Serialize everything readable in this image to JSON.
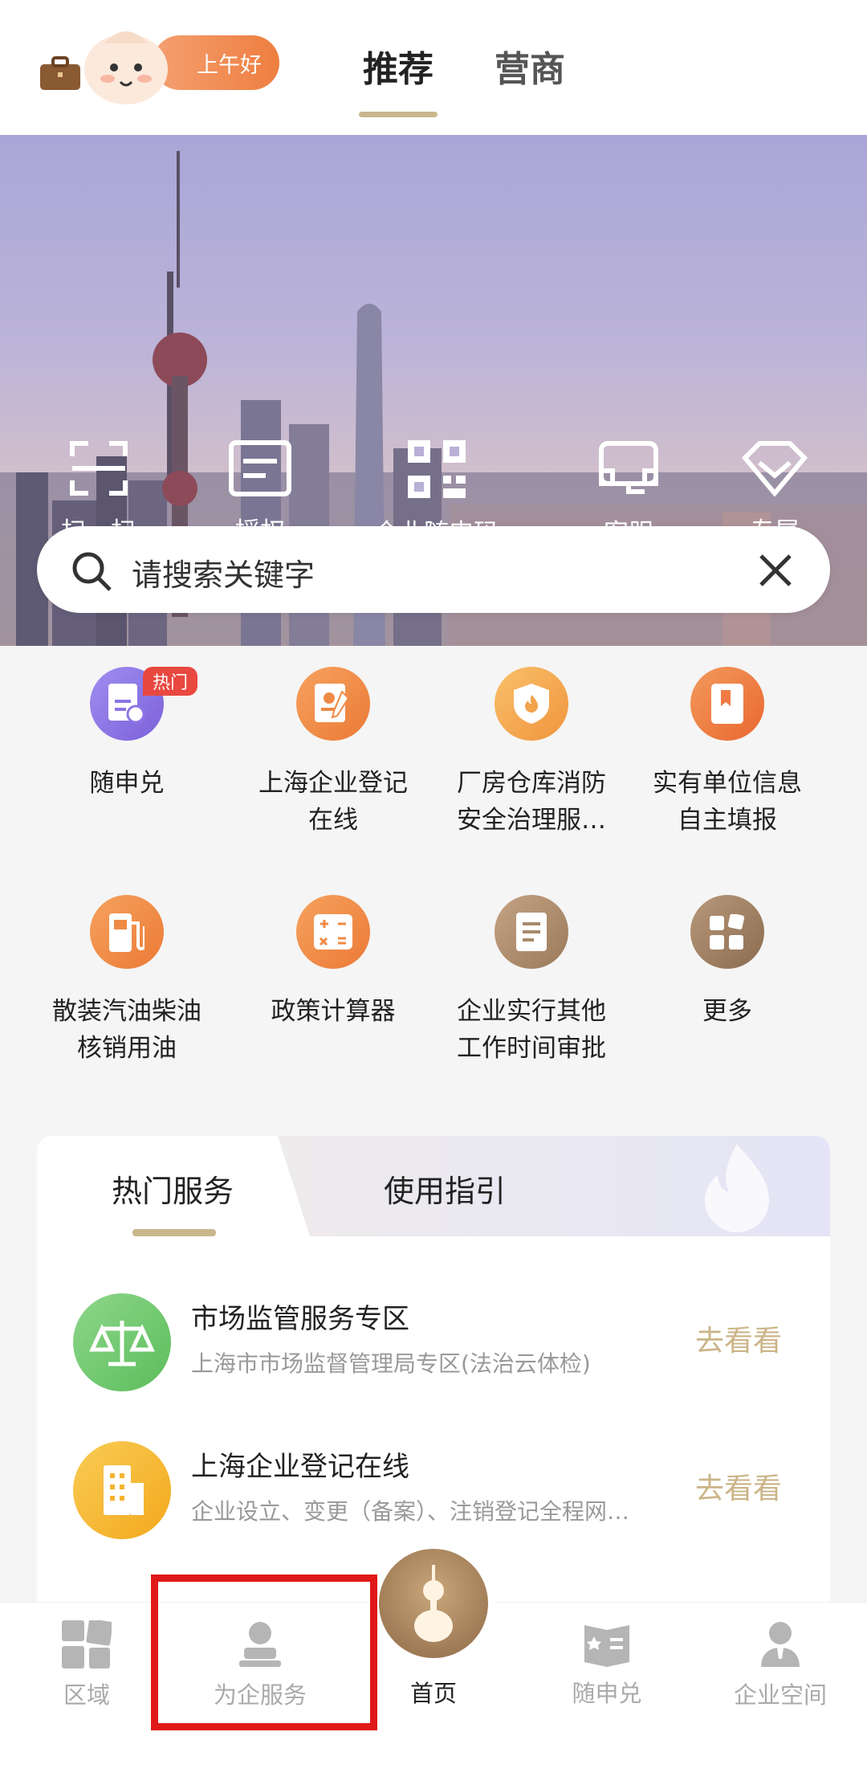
{
  "header": {
    "greeting": "上午好",
    "tabs": [
      {
        "label": "推荐",
        "active": true
      },
      {
        "label": "营商",
        "active": false
      }
    ]
  },
  "quick_actions": [
    {
      "label": "扫一扫",
      "icon": "scan-icon"
    },
    {
      "label": "授权",
      "icon": "authorize-icon"
    },
    {
      "label": "企业随申码",
      "icon": "qr-code-icon"
    },
    {
      "label": "客服",
      "icon": "customer-service-icon"
    },
    {
      "label": "专属",
      "icon": "exclusive-icon"
    }
  ],
  "search": {
    "placeholder": "请搜索关键字"
  },
  "services": {
    "hot_badge": "热门",
    "items": [
      {
        "line1": "随申兑",
        "line2": "",
        "color": "#8d74e6"
      },
      {
        "line1": "上海企业登记",
        "line2": "在线",
        "color": "#ef8a45"
      },
      {
        "line1": "厂房仓库消防",
        "line2": "安全治理服…",
        "color": "#f2a24c"
      },
      {
        "line1": "实有单位信息",
        "line2": "自主填报",
        "color": "#ef7a45"
      },
      {
        "line1": "散装汽油柴油",
        "line2": "核销用油",
        "color": "#ef8a45"
      },
      {
        "line1": "政策计算器",
        "line2": "",
        "color": "#ef8a45"
      },
      {
        "line1": "企业实行其他",
        "line2": "工作时间审批",
        "color": "#a88a6c"
      },
      {
        "line1": "更多",
        "line2": "",
        "color": "#9a7a5c"
      }
    ]
  },
  "card": {
    "tabs": [
      {
        "label": "热门服务",
        "active": true
      },
      {
        "label": "使用指引",
        "active": false
      }
    ],
    "rows": [
      {
        "title": "市场监管服务专区",
        "subtitle": "上海市市场监督管理局专区(法治云体检)",
        "action": "去看看",
        "color": "#6fc56e"
      },
      {
        "title": "上海企业登记在线",
        "subtitle": "企业设立、变更（备案）、注销登记全程网…",
        "action": "去看看",
        "color": "#f6b32e"
      }
    ]
  },
  "bottom_nav": [
    {
      "label": "区域",
      "icon": "region-icon",
      "active": false
    },
    {
      "label": "为企服务",
      "icon": "enterprise-service-icon",
      "active": false
    },
    {
      "label": "首页",
      "icon": "home-icon",
      "active": true
    },
    {
      "label": "随申兑",
      "icon": "suishendui-icon",
      "active": false
    },
    {
      "label": "企业空间",
      "icon": "enterprise-space-icon",
      "active": false
    }
  ],
  "highlight_color": "#e01818"
}
